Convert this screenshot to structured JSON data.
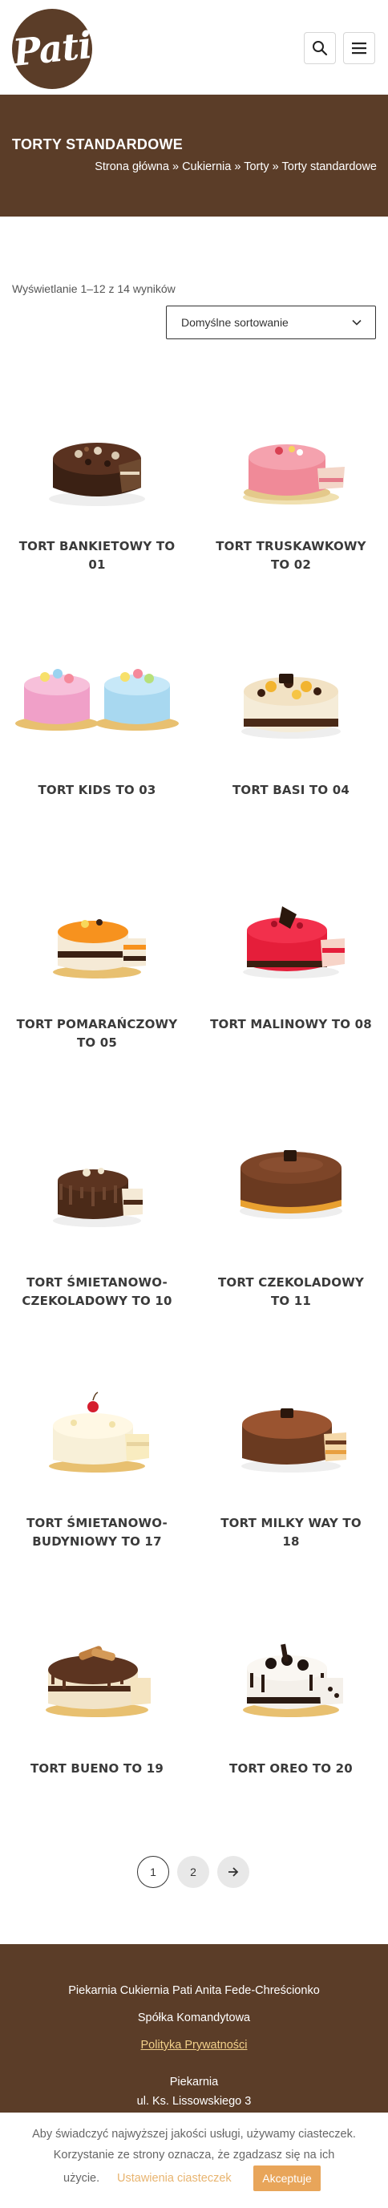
{
  "header": {
    "logo_text": "Pati",
    "search_icon": "search-icon",
    "menu_icon": "hamburger-menu-icon"
  },
  "banner": {
    "title": "TORTY STANDARDOWE",
    "breadcrumb": [
      "Strona główna",
      "Cukiernia",
      "Torty",
      "Torty standardowe"
    ],
    "separator": "»"
  },
  "shop": {
    "results_text": "Wyświetlanie 1–12 z 14 wyników",
    "sort_label": "Domyślne sortowanie"
  },
  "products": [
    {
      "title": "TORT BANKIETOWY TO 01",
      "image": "cake-chocolate-crumb"
    },
    {
      "title": "TORT TRUSKAWKOWY TO 02",
      "image": "cake-strawberry-pink"
    },
    {
      "title": "TORT KIDS TO 03",
      "image": "cake-kids-pastel"
    },
    {
      "title": "TORT BASI TO 04",
      "image": "cake-basi-cream"
    },
    {
      "title": "TORT POMARAŃCZOWY TO 05",
      "image": "cake-orange"
    },
    {
      "title": "TORT MALINOWY TO 08",
      "image": "cake-raspberry"
    },
    {
      "title": "TORT ŚMIETANOWO-CZEKOLADOWY TO 10",
      "image": "cake-cream-chocolate"
    },
    {
      "title": "TORT CZEKOLADOWY TO 11",
      "image": "cake-chocolate-glaze"
    },
    {
      "title": "TORT ŚMIETANOWO-BUDYNIOWY TO 17",
      "image": "cake-cream-pudding"
    },
    {
      "title": "TORT MILKY WAY TO 18",
      "image": "cake-milky-way"
    },
    {
      "title": "TORT BUENO TO 19",
      "image": "cake-bueno"
    },
    {
      "title": "TORT OREO TO 20",
      "image": "cake-oreo"
    }
  ],
  "pagination": {
    "current": "1",
    "page2": "2",
    "next_icon": "arrow-right-icon"
  },
  "footer": {
    "company_line1": "Piekarnia Cukiernia Pati Anita Fede-Chreścionko",
    "company_line2": "Spółka Komandytowa",
    "privacy_link": "Polityka Prywatności",
    "section": "Piekarnia",
    "address": "ul. Ks. Lissowskiego 3"
  },
  "cookie": {
    "text": "Aby świadczyć najwyższej jakości usługi, używamy ciasteczek. Korzystanie ze strony oznacza, że zgadzasz się na ich",
    "prefix": "użycie.",
    "settings": "Ustawienia ciasteczek",
    "accept": "Akceptuje"
  },
  "colors": {
    "brand_brown": "#5b3d28",
    "accent_orange": "#e8a55a",
    "link_gold": "#f2d08a"
  }
}
